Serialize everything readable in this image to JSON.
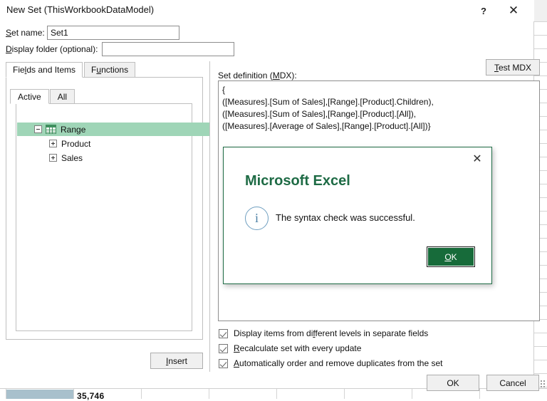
{
  "background_sheet": {
    "selected_cell_value": "35,746"
  },
  "dialog": {
    "title": "New Set (ThisWorkbookDataModel)",
    "help_icon": "?",
    "close_icon": "✕",
    "set_name_label": "Set name:",
    "set_name_value": "Set1",
    "set_name_placeholder": "",
    "display_folder_label": "Display folder (optional):",
    "display_folder_value": "",
    "display_folder_placeholder": "",
    "tabs": [
      {
        "label": "Fields and Items",
        "active": true
      },
      {
        "label": "Functions",
        "active": false
      }
    ],
    "subtabs": [
      {
        "label": "Active",
        "active": true
      },
      {
        "label": "All",
        "active": false
      }
    ],
    "tree": [
      {
        "label": "Range",
        "state": "expanded",
        "selected": true,
        "icon": "table-grid-icon"
      },
      {
        "label": "Product",
        "state": "collapsed",
        "selected": false
      },
      {
        "label": "Sales",
        "state": "collapsed",
        "selected": false
      }
    ],
    "insert_label": "Insert",
    "set_definition_label": "Set definition (MDX):",
    "test_mdx_label": "Test MDX",
    "mdx_text": "{\n([Measures].[Sum of Sales],[Range].[Product].Children),\n([Measures].[Sum of Sales],[Range].[Product].[All]),\n([Measures].[Average of Sales],[Range].[Product].[All])}",
    "options": [
      {
        "label": "Display items from different levels in separate fields",
        "checked": true
      },
      {
        "label": "Recalculate set with every update",
        "checked": true
      },
      {
        "label": "Automatically order and remove duplicates from the set",
        "checked": true
      }
    ],
    "ok_label": "OK",
    "cancel_label": "Cancel"
  },
  "messagebox": {
    "app_title": "Microsoft Excel",
    "message": "The syntax check was successful.",
    "ok_label": "OK",
    "close_icon": "✕",
    "info_icon_glyph": "i"
  },
  "colors": {
    "excel_green": "#1e6b45",
    "ok_button_green": "#176b3a",
    "tree_selection": "#9fd5b7",
    "info_icon_blue": "#4a7fa5"
  }
}
